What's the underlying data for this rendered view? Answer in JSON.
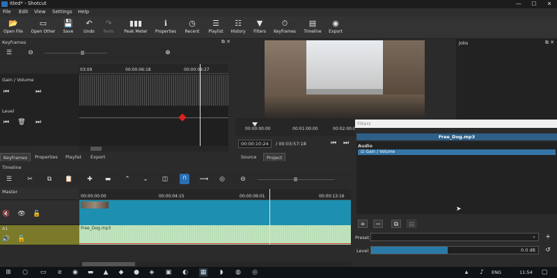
{
  "window": {
    "title": "itled* - Shotcut",
    "minimize": "—",
    "maximize": "☐",
    "close": "✕"
  },
  "menu": [
    "File",
    "Edit",
    "View",
    "Settings",
    "Help"
  ],
  "toolbar": [
    {
      "label": "Open File",
      "icon": "folder-icon",
      "glyph": "📂"
    },
    {
      "label": "Open Other",
      "icon": "open-other-icon",
      "glyph": "▭"
    },
    {
      "label": "Save",
      "icon": "save-icon",
      "glyph": "💾"
    },
    {
      "label": "Undo",
      "icon": "undo-icon",
      "glyph": "↶"
    },
    {
      "label": "Redo",
      "icon": "redo-icon",
      "glyph": "↷"
    },
    {
      "label": "Peak Meter",
      "icon": "peak-meter-icon",
      "glyph": "▮▮▮"
    },
    {
      "label": "Properties",
      "icon": "info-icon",
      "glyph": "ℹ"
    },
    {
      "label": "Recent",
      "icon": "clock-icon",
      "glyph": "◷"
    },
    {
      "label": "Playlist",
      "icon": "playlist-icon",
      "glyph": "☰"
    },
    {
      "label": "History",
      "icon": "history-icon",
      "glyph": "☷"
    },
    {
      "label": "Filters",
      "icon": "filter-icon",
      "glyph": "▼"
    },
    {
      "label": "Keyframes",
      "icon": "stopwatch-icon",
      "glyph": "⏱"
    },
    {
      "label": "Timeline",
      "icon": "timeline-icon",
      "glyph": "▤"
    },
    {
      "label": "Export",
      "icon": "export-icon",
      "glyph": "◉"
    }
  ],
  "keyframes": {
    "title": "Keyframes",
    "ruler": [
      "03:09",
      "00:00:06:18",
      "00:00:09:27"
    ],
    "tracks": [
      "Gain / Volume",
      "Level"
    ]
  },
  "player": {
    "ruler": [
      "00:00:00:00",
      "00:01:00:00",
      "00:02:00:00"
    ],
    "current": "00:00:10:24",
    "total": "/ 00:03:57:18",
    "tabs": [
      "Source",
      "Project"
    ]
  },
  "jobs": {
    "title": "Jobs"
  },
  "filters": {
    "title": "Filters",
    "clip_name": "Free_Dog.mp3",
    "section": "Audio",
    "items": [
      "Gain / Volume"
    ],
    "preset_label": "Preset",
    "level_label": "Level",
    "level_value": "0.0 dB",
    "level_fraction": 0.46
  },
  "left_tabs": [
    "Keyframes",
    "Properties",
    "Playlist",
    "Export"
  ],
  "timeline": {
    "title": "Timeline",
    "ruler": [
      "00:00:00:00",
      "00:00:04:15",
      "00:00:09:01",
      "00:00:13:16"
    ],
    "tracks": [
      "Master",
      "",
      "A1"
    ],
    "audio_clip": "Free_Dog.mp3"
  },
  "taskbar": {
    "lang": "ENG",
    "time": "11:54"
  },
  "colors": {
    "accent": "#1d8fb0",
    "audio_track": "#7a7a2a",
    "keyframe": "#e02020"
  }
}
